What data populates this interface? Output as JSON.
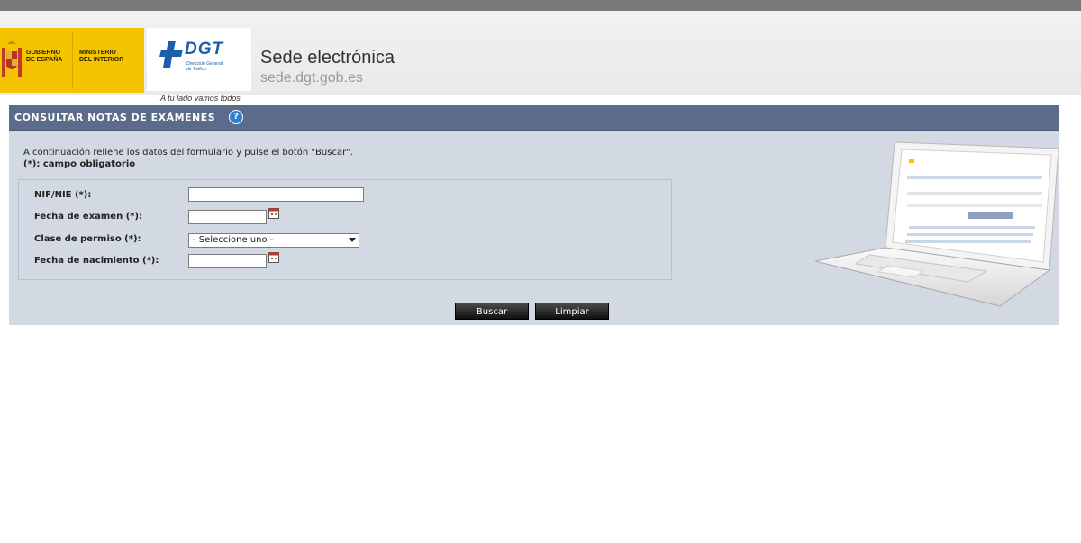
{
  "header": {
    "gov_label_1": "GOBIERNO\nDE ESPAÑA",
    "gov_label_2": "MINISTERIO\nDEL INTERIOR",
    "dgt_name": "DGT",
    "dgt_sub": "Dirección General\nde Tráfico",
    "slogan": "A tu lado vamos todos",
    "site_title": "Sede electrónica",
    "site_url": "sede.dgt.gob.es"
  },
  "panel": {
    "title": "CONSULTAR NOTAS DE EXÁMENES",
    "help_icon": "?",
    "intro": "A continuación rellene los datos del formulario y pulse el botón \"Buscar\".",
    "required_note": "(*): campo obligatorio"
  },
  "form": {
    "nif_label": "NIF/NIE (*):",
    "nif_value": "",
    "exam_date_label": "Fecha de examen (*):",
    "exam_date_value": "",
    "license_class_label": "Clase de permiso (*):",
    "license_class_selected": "- Seleccione uno -",
    "birth_date_label": "Fecha de nacimiento (*):",
    "birth_date_value": ""
  },
  "buttons": {
    "search": "Buscar",
    "clear": "Limpiar"
  },
  "colors": {
    "panel_header": "#5b6b8a",
    "panel_body": "#d2d9e2",
    "gov_yellow": "#f5c400",
    "dgt_blue": "#1a5fa8"
  },
  "icons": [
    "coat-of-arms-icon",
    "dgt-logo-icon",
    "help-icon",
    "calendar-icon",
    "chevron-down-icon",
    "laptop-illustration"
  ]
}
